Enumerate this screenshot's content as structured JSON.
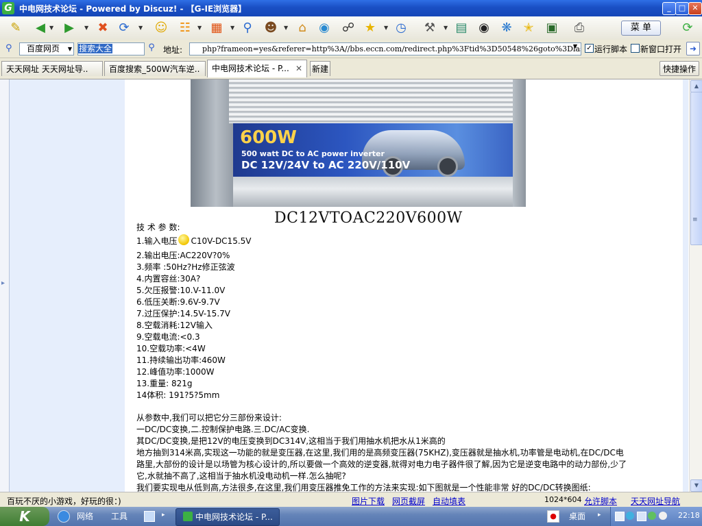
{
  "window": {
    "title": "中电网技术论坛 - Powered by Discuz! - 【G-IE浏览器】",
    "logo_letter": "G",
    "controls": [
      "_",
      "□",
      "✕"
    ]
  },
  "toolbar": {
    "menu_label": "菜 单",
    "icons": [
      "new-page-icon",
      "back-icon",
      "forward-icon",
      "stop-icon",
      "refresh-icon",
      "smiley-icon",
      "rss-icon",
      "favorites-bar-icon",
      "search-icon",
      "user-icon",
      "home-icon",
      "messenger-icon",
      "cart-icon",
      "star-icon",
      "history-icon",
      "tools-icon",
      "books-icon",
      "panda-icon",
      "network-icon",
      "bookmark-star-icon",
      "gallery-icon",
      "print-icon",
      "reload-icon"
    ]
  },
  "addressbar": {
    "search_engine": "百度网页",
    "search_value": "搜索大全",
    "address_label": "地址:",
    "url": "php?frameon=yes&referer=http%3A//bbs.eccn.com/redirect.php%3Ftid%3D50548%26goto%3Dlastpost",
    "run_script_label": "运行脚本",
    "run_script_checked": true,
    "new_window_label": "新窗口打开",
    "new_window_checked": false
  },
  "tabs": [
    {
      "label": "天天网址 天天网址导.."
    },
    {
      "label": "百度搜索_500W汽车逆.."
    },
    {
      "label": "中电网技术论坛 - P...",
      "active": true
    }
  ],
  "tabbar": {
    "new_tab_label": "新建",
    "quick_ops_label": "快捷操作"
  },
  "content": {
    "inverter": {
      "big": "600W",
      "line1": "500 watt DC to AC power inverter",
      "line2": "DC 12V/24V to AC 220V/110V"
    },
    "model": "DC12VTOAC220V600W",
    "spec_title": "技 术 参 数:",
    "specs": {
      "s1a": "1.输入电压",
      "s1b": "C10V-DC15.5V",
      "s2": "2.输出电压:AC220V?0%",
      "s3": "3.频率  :50Hz?Hz修正弦波",
      "s4": "4.内置容丝:30A?",
      "s5": "5.欠压报警:10.V-11.0V",
      "s6": "6.低压关断:9.6V-9.7V",
      "s7": "7.过压保护:14.5V-15.7V",
      "s8": "8.空载消耗:12V输入",
      "s9": "9.空载电流:<0.3",
      "s10": "10.空载功率:<4W",
      "s11": "11.持续输出功率:460W",
      "s12": "12.峰值功率:1000W",
      "s13": "13.重量: 821g",
      "s14": "14体积: 191?5?5mm"
    },
    "para": {
      "p1": "从参数中,我们可以把它分三部份来设计:",
      "p2": "一DC/DC变换,二.控制保护电路.三.DC/AC变换.",
      "p3": "其DC/DC变换,是把12V的电压变换到DC314V,这相当于我们用抽水机把水从1米高的",
      "p4": "地方抽到314米高,实现这一功能的就是变压器,在这里,我们用的是高频变压器(75KHZ),变压器就是抽水机,功率管是电动机,在DC/DC电",
      "p5": "路里,大部份的设计是以场管为核心设计的,所以要做一个高效的逆变器,就得对电力电子器件很了解,因为它是逆变电路中的动力部份,少了",
      "p6": "它,水就抽不高了,这相当于抽水机没电动机一样.怎么抽呢?",
      "p7": "我们要实现电从低到高,方法很多,在这里,我们用变压器推免工作的方法来实现:如下图就是一个性能非常 好的DC/DC转换图纸:"
    }
  },
  "statusbar": {
    "message": "百玩不厌的小游戏，好玩的很：)",
    "links": [
      "图片下载",
      "网页截屏",
      "自动填表"
    ],
    "resolution": "1024*604",
    "allow_script": "允许脚本",
    "nav_link": "天天网址导航"
  },
  "taskbar": {
    "start_label": "K",
    "items": [
      "网络",
      "工具"
    ],
    "active_task": "中电网技术论坛 - P...",
    "desktop_label": "桌面",
    "clock": "22:18"
  }
}
